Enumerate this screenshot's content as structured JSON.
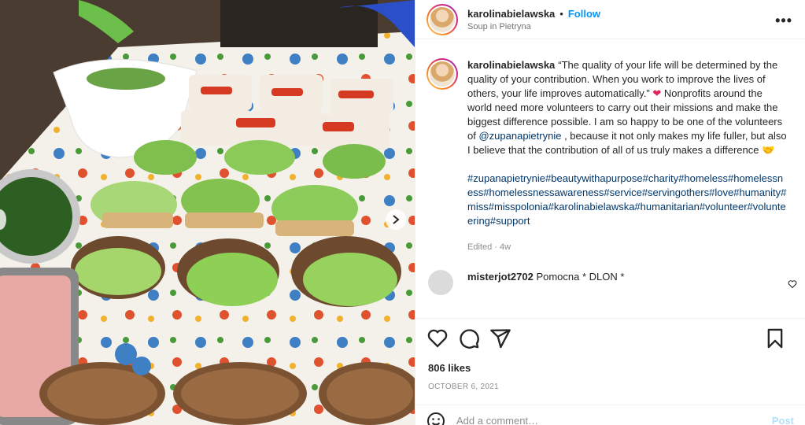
{
  "post": {
    "username": "karolinabielawska",
    "separator": "•",
    "follow_label": "Follow",
    "location": "Soup in Pietryna",
    "more_icon": "more-horizontal-icon"
  },
  "caption": {
    "username": "karolinabielawska",
    "text_part1": "“The quality of your life will be determined by the quality of your contribution. When you work to improve the lives of others, your life improves automatically.”",
    "heart_emoji": "❤",
    "text_part2": "Nonprofits around the world need more volunteers to carry out their missions and make the biggest difference possible. I am so happy to be one of the volunteers of",
    "mention": "@zupanapietrynie",
    "text_part3": ", because it not only makes my life fuller, but also I believe that the contribution of all of us truly makes a difference",
    "hand_emoji": "🤝",
    "hashtags": "#zupanapietrynie#beautywithapurpose#charity#homeless#homelessness#homelessnessawareness#service#servingothers#love#humanity#miss#misspolonia#karolinabielawska#humanitarian#volunteer#volunteering#support",
    "edited": "Edited · 4w"
  },
  "comment": {
    "username": "misterjot2702",
    "text": "Pomocna * DLON *"
  },
  "actions": {
    "like_icon": "heart-icon",
    "comment_icon": "comment-icon",
    "share_icon": "share-icon",
    "save_icon": "bookmark-icon"
  },
  "likes": "806 likes",
  "date": "OCTOBER 6, 2021",
  "add_comment": {
    "placeholder": "Add a comment…",
    "post_label": "Post",
    "emoji_icon": "smiley-icon"
  },
  "colors": {
    "link_blue": "#0095f6",
    "mention_blue": "#00376b",
    "heart_red": "#e0245e"
  }
}
